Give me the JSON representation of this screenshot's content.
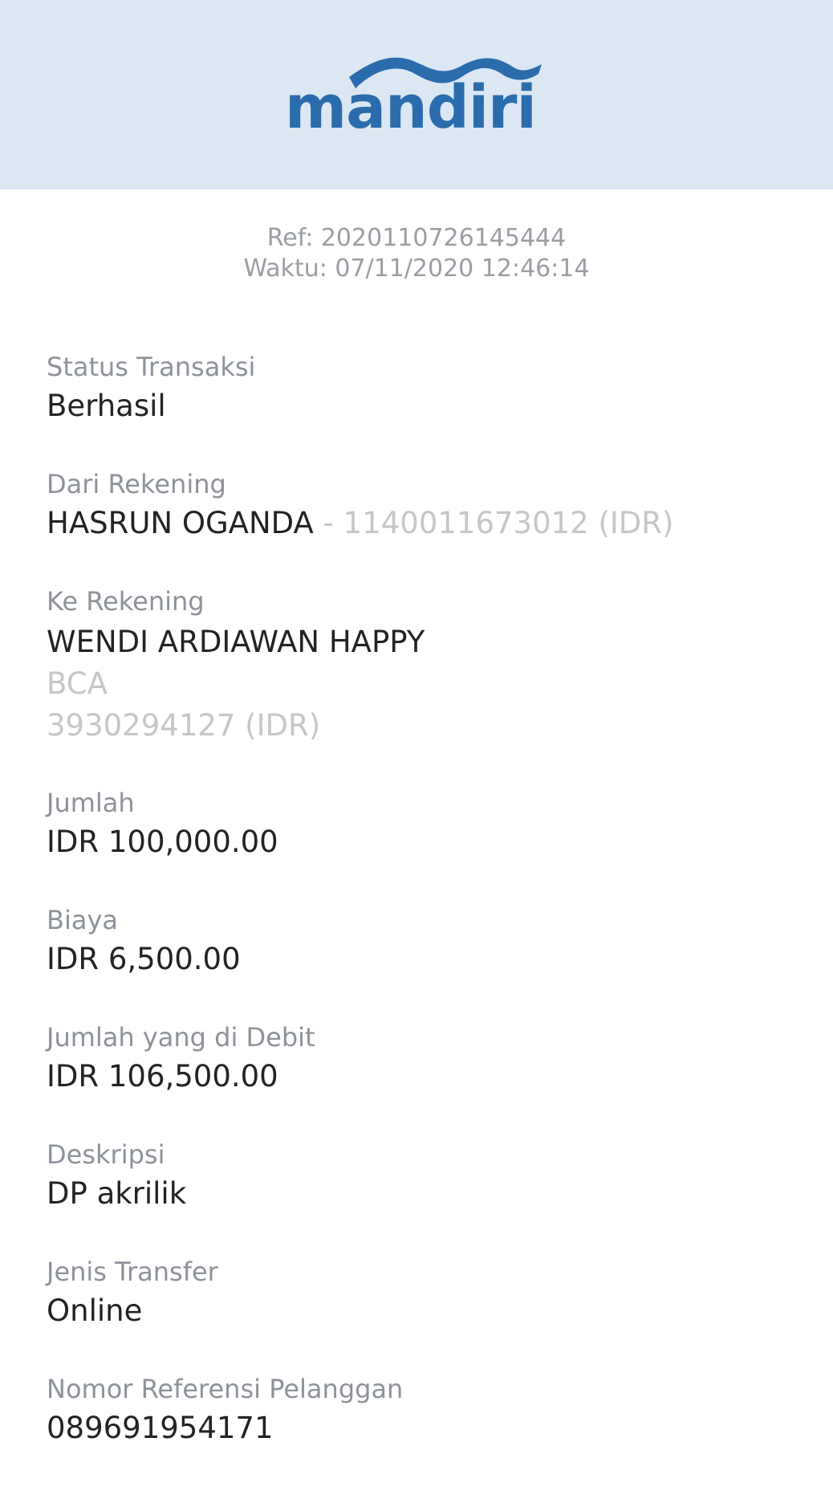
{
  "brand": {
    "logo_text": "mandiri",
    "header_bg": "#dbe7f3",
    "logo_color": "#2b6cad"
  },
  "meta": {
    "ref": "Ref: 2020110726145444",
    "time": "Waktu: 07/11/2020 12:46:14"
  },
  "fields": {
    "status": {
      "label": "Status Transaksi",
      "value": "Berhasil"
    },
    "from_account": {
      "label": "Dari Rekening",
      "name": "HASRUN OGANDA",
      "detail": " - 1140011673012 (IDR)"
    },
    "to_account": {
      "label": "Ke Rekening",
      "name": "WENDI ARDIAWAN HAPPY",
      "bank": "BCA",
      "number": "3930294127 (IDR)"
    },
    "amount": {
      "label": "Jumlah",
      "value": "IDR 100,000.00"
    },
    "fee": {
      "label": "Biaya",
      "value": "IDR 6,500.00"
    },
    "debited": {
      "label": "Jumlah yang di Debit",
      "value": "IDR 106,500.00"
    },
    "description": {
      "label": "Deskripsi",
      "value": "DP akrilik"
    },
    "transfer_type": {
      "label": "Jenis Transfer",
      "value": "Online"
    },
    "customer_ref": {
      "label": "Nomor Referensi Pelanggan",
      "value": "089691954171"
    }
  }
}
